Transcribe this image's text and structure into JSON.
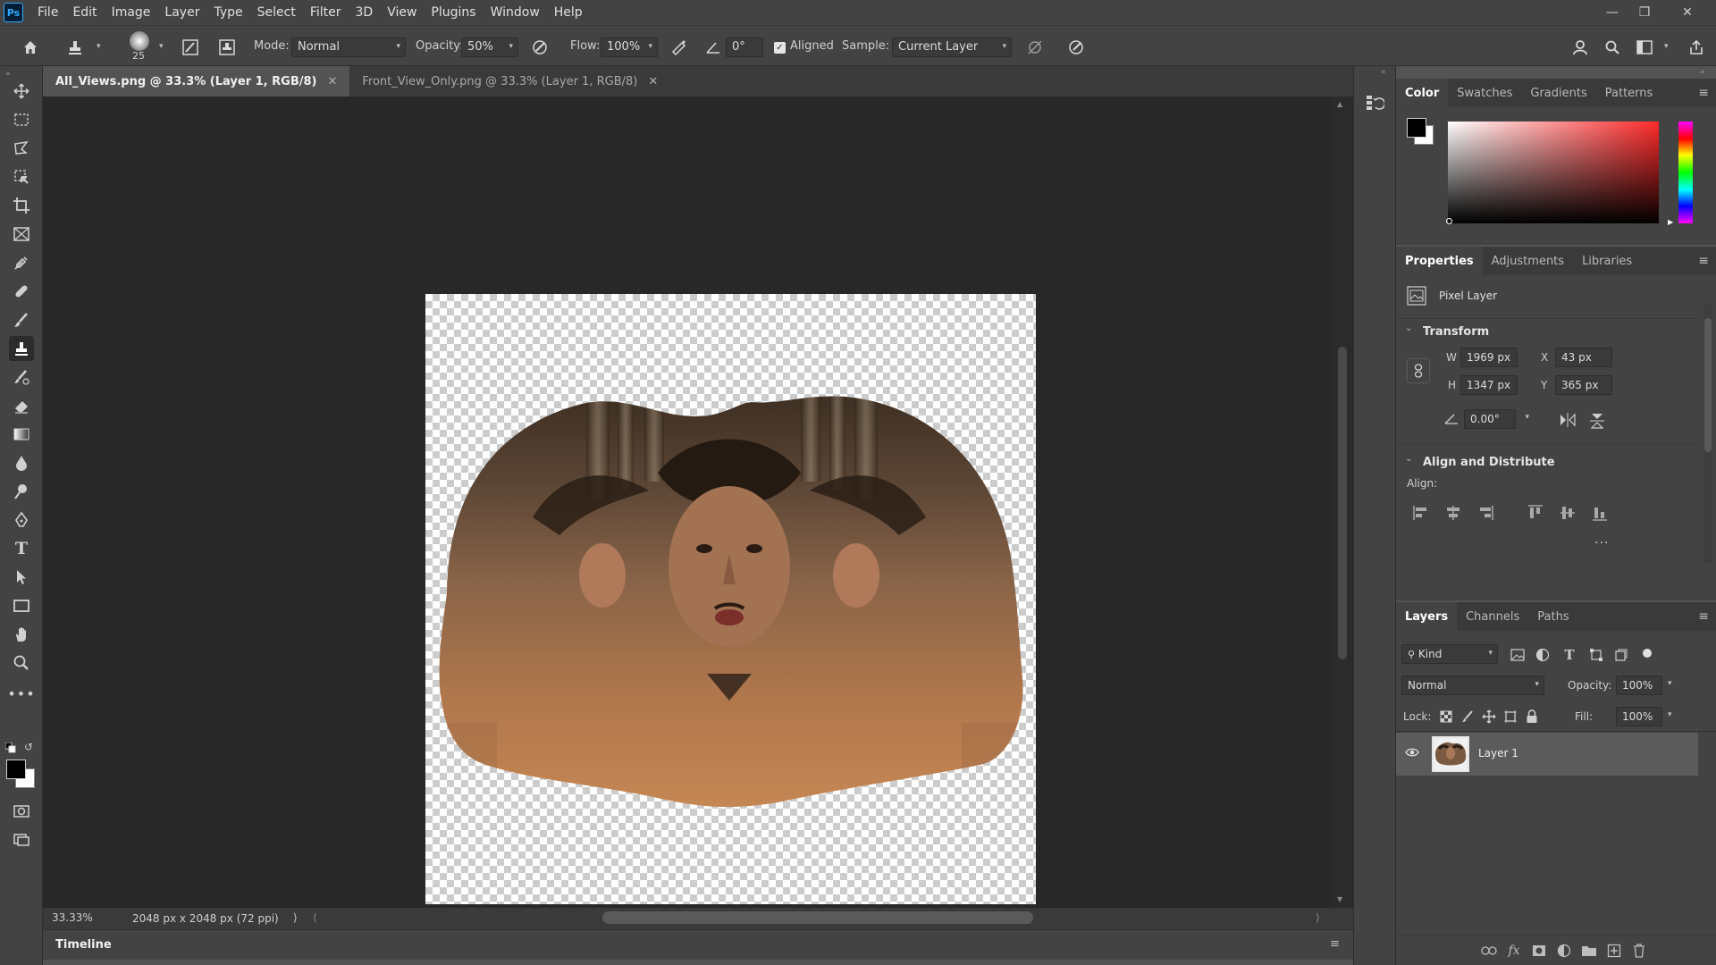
{
  "app": {
    "logo": "Ps"
  },
  "menu": [
    "File",
    "Edit",
    "Image",
    "Layer",
    "Type",
    "Select",
    "Filter",
    "3D",
    "View",
    "Plugins",
    "Window",
    "Help"
  ],
  "options": {
    "brush_size": "25",
    "mode_label": "Mode:",
    "mode_value": "Normal",
    "opacity_label": "Opacity:",
    "opacity_value": "50%",
    "flow_label": "Flow:",
    "flow_value": "100%",
    "angle_value": "0°",
    "aligned_label": "Aligned",
    "aligned_checked": true,
    "sample_label": "Sample:",
    "sample_value": "Current Layer"
  },
  "tabs": [
    {
      "label": "All_Views.png @ 33.3% (Layer 1, RGB/8)",
      "active": true
    },
    {
      "label": "Front_View_Only.png @ 33.3% (Layer 1, RGB/8)",
      "active": false
    }
  ],
  "status": {
    "zoom": "33.33%",
    "doc_info": "2048 px x 2048 px (72 ppi)"
  },
  "timeline": {
    "label": "Timeline"
  },
  "color_panel": {
    "tabs": [
      "Color",
      "Swatches",
      "Gradients",
      "Patterns"
    ],
    "foreground": "#000000",
    "background": "#ffffff",
    "hue": "#ff2a2a"
  },
  "properties_panel": {
    "tabs": [
      "Properties",
      "Adjustments",
      "Libraries"
    ],
    "layer_type": "Pixel Layer",
    "transform_title": "Transform",
    "w_label": "W",
    "w_value": "1969 px",
    "h_label": "H",
    "h_value": "1347 px",
    "x_label": "X",
    "x_value": "43 px",
    "y_label": "Y",
    "y_value": "365 px",
    "angle_value": "0.00°",
    "align_title": "Align and Distribute",
    "align_label": "Align:",
    "more": "..."
  },
  "layers_panel": {
    "tabs": [
      "Layers",
      "Channels",
      "Paths"
    ],
    "filter_value": "Kind",
    "blend_mode": "Normal",
    "opacity_label": "Opacity:",
    "opacity_value": "100%",
    "lock_label": "Lock:",
    "fill_label": "Fill:",
    "fill_value": "100%",
    "layers": [
      {
        "name": "Layer 1",
        "visible": true
      }
    ]
  }
}
